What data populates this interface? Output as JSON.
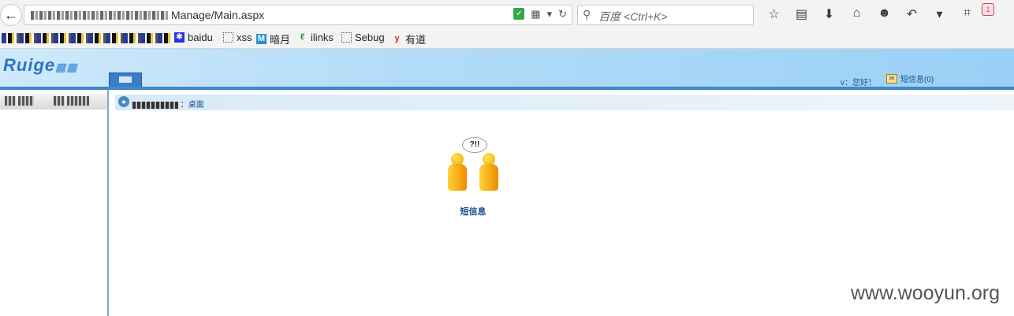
{
  "browser": {
    "url_tail": "Manage/Main.aspx",
    "search_placeholder": "百度 <Ctrl+K>",
    "notification_count": "1",
    "bookmarks": [
      "baidu",
      "xss",
      "暗月",
      "ilinks",
      "Sebug",
      "有道"
    ]
  },
  "app": {
    "logo_text": "Ruige",
    "greeting": "v：您好！",
    "messages_label": "短信息(0)",
    "breadcrumb_link": "桌面"
  },
  "desktop": {
    "icon_label": "短信息",
    "bubble_text": "?!!"
  },
  "watermark": "www.wooyun.org",
  "colors": {
    "header_gradient_end": "#9ad0f6",
    "header_rule": "#3f87c9",
    "link": "#1a4f8c"
  }
}
